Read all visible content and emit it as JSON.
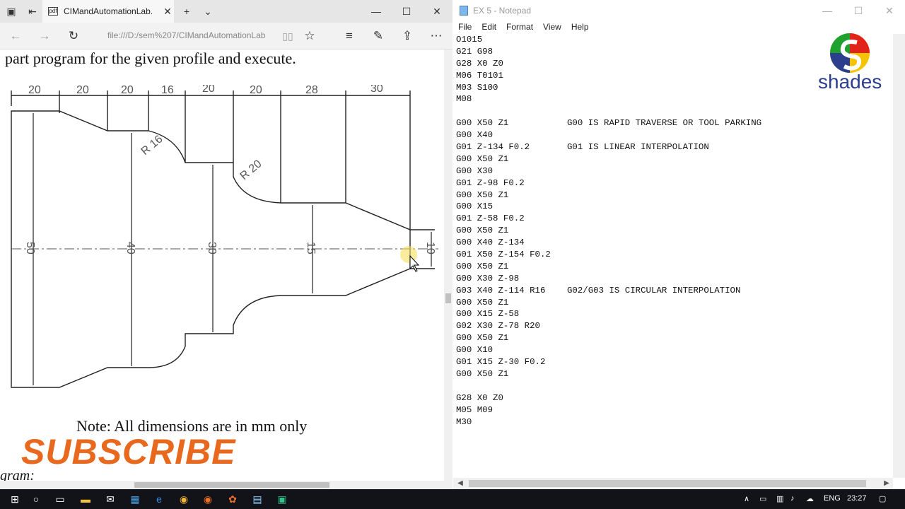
{
  "browser": {
    "tab_title": "CIMandAutomationLab.",
    "url": "file:///D:/sem%207/CIMandAutomationLab",
    "heading": "part program for the given profile and execute.",
    "note": "Note: All dimensions are in mm only",
    "subscribe": "SUBSCRIBE",
    "bottom_partial": "gram:",
    "drawing": {
      "top_dims": [
        "20",
        "20",
        "20",
        "16",
        "20",
        "20",
        "28",
        "30"
      ],
      "radius_labels": [
        "R 16",
        "R 20"
      ],
      "diameter_labels": [
        "50",
        "40",
        "30",
        "15",
        "10"
      ]
    }
  },
  "notepad": {
    "title": "EX 5 - Notepad",
    "menu": [
      "File",
      "Edit",
      "Format",
      "View",
      "Help"
    ],
    "lines": [
      {
        "code": "O1015",
        "comment": ""
      },
      {
        "code": "G21 G98",
        "comment": ""
      },
      {
        "code": "G28 X0 Z0",
        "comment": ""
      },
      {
        "code": "M06 T0101",
        "comment": ""
      },
      {
        "code": "M03 S100",
        "comment": ""
      },
      {
        "code": "M08",
        "comment": ""
      },
      {
        "code": "",
        "comment": ""
      },
      {
        "code": "G00 X50 Z1",
        "comment": "G00 IS RAPID TRAVERSE OR TOOL PARKING"
      },
      {
        "code": "G00 X40",
        "comment": ""
      },
      {
        "code": "G01 Z-134 F0.2",
        "comment": "G01 IS LINEAR INTERPOLATION"
      },
      {
        "code": "G00 X50 Z1",
        "comment": ""
      },
      {
        "code": "G00 X30",
        "comment": ""
      },
      {
        "code": "G01 Z-98 F0.2",
        "comment": ""
      },
      {
        "code": "G00 X50 Z1",
        "comment": ""
      },
      {
        "code": "G00 X15",
        "comment": ""
      },
      {
        "code": "G01 Z-58 F0.2",
        "comment": ""
      },
      {
        "code": "G00 X50 Z1",
        "comment": ""
      },
      {
        "code": "G00 X40 Z-134",
        "comment": ""
      },
      {
        "code": "G01 X50 Z-154 F0.2",
        "comment": ""
      },
      {
        "code": "G00 X50 Z1",
        "comment": ""
      },
      {
        "code": "G00 X30 Z-98",
        "comment": ""
      },
      {
        "code": "G03 X40 Z-114 R16",
        "comment": "G02/G03 IS CIRCULAR INTERPOLATION"
      },
      {
        "code": "G00 X50 Z1",
        "comment": ""
      },
      {
        "code": "G00 X15 Z-58",
        "comment": ""
      },
      {
        "code": "G02 X30 Z-78 R20",
        "comment": ""
      },
      {
        "code": "G00 X50 Z1",
        "comment": ""
      },
      {
        "code": "G00 X10",
        "comment": ""
      },
      {
        "code": "G01 X15 Z-30 F0.2",
        "comment": ""
      },
      {
        "code": "G00 X50 Z1",
        "comment": ""
      },
      {
        "code": "",
        "comment": ""
      },
      {
        "code": "G28 X0 Z0",
        "comment": ""
      },
      {
        "code": "M05 M09",
        "comment": ""
      },
      {
        "code": "M30",
        "comment": ""
      }
    ]
  },
  "logo": {
    "text": "shades"
  },
  "taskbar": {
    "language": "ENG",
    "time": "23:27"
  },
  "colors": {
    "subscribe": "#e8681e",
    "logo_text": "#2b3f8c",
    "taskbar": "#111319"
  }
}
